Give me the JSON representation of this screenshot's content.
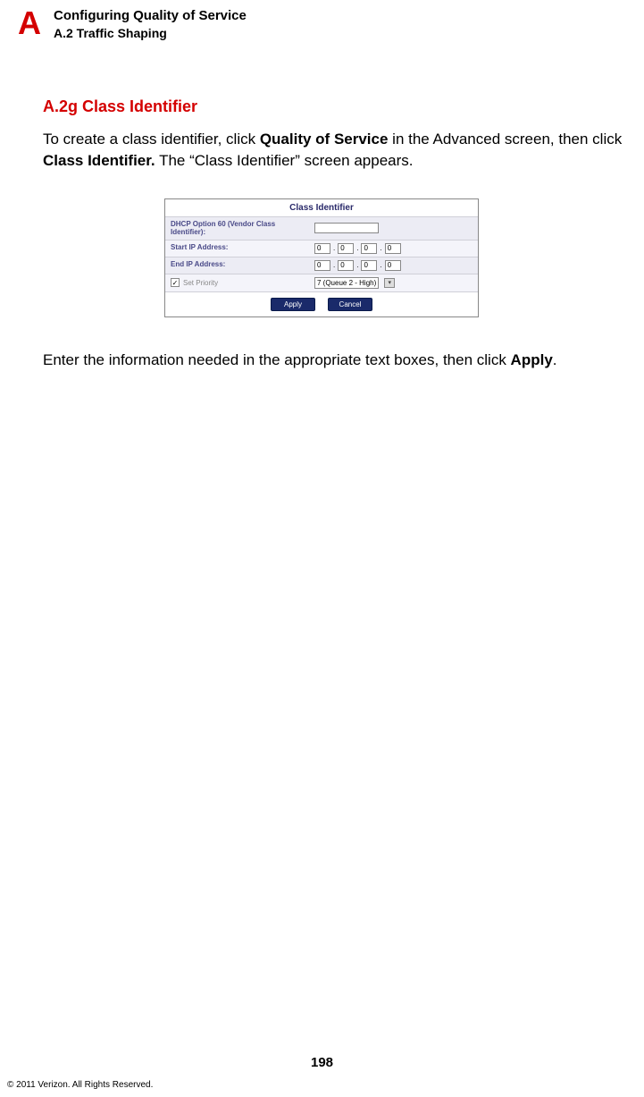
{
  "header": {
    "letter": "A",
    "title": "Configuring Quality of Service",
    "subtitle": "A.2  Traffic Shaping"
  },
  "section": {
    "heading": "A.2g  Class Identifier",
    "para1_pre": "To create a class identifier, click ",
    "para1_b1": "Quality of Service",
    "para1_mid": " in the Advanced screen, then click ",
    "para1_b2": "Class Identifier.",
    "para1_end": " The “Class Identifier” screen appears.",
    "para2_pre": "Enter the information needed in the appropriate text boxes, then click ",
    "para2_b1": "Apply",
    "para2_end": "."
  },
  "shot": {
    "title": "Class Identifier",
    "row_dhcp": "DHCP Option 60 (Vendor Class Identifier):",
    "row_start": "Start IP Address:",
    "row_end": "End IP Address:",
    "row_priority": "Set Priority",
    "check_mark": "✓",
    "octet": "0",
    "sel_value": "7 (Queue 2 - High)",
    "btn_apply": "Apply",
    "btn_cancel": "Cancel"
  },
  "footer": {
    "page": "198",
    "copyright": "© 2011 Verizon. All Rights Reserved."
  }
}
